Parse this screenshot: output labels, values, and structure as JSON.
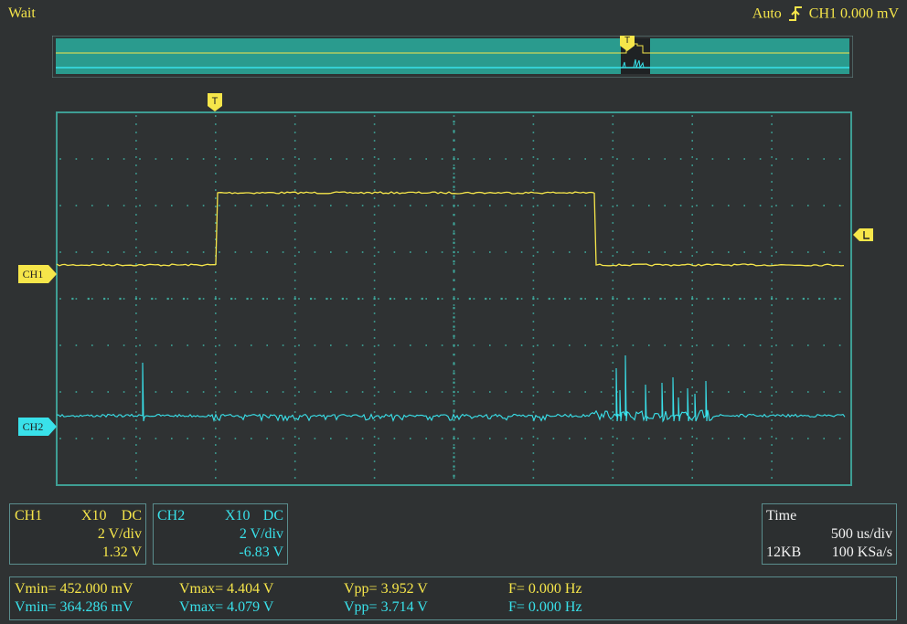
{
  "header": {
    "status": "Wait",
    "trigger_mode": "Auto",
    "trigger_source": "CH1",
    "trigger_level": "0.000 mV"
  },
  "markers": {
    "trigger": "T",
    "ch1": "CH1",
    "ch2": "CH2"
  },
  "colors": {
    "ch1": "#f6e64a",
    "ch2": "#39e1ea",
    "grid_border": "#3e9e94",
    "background": "#2f3233",
    "overview_fill": "#2a9b8e"
  },
  "channels": [
    {
      "name": "CH1",
      "probe": "X10",
      "coupling": "DC",
      "scale": "2 V/div",
      "offset": "1.32 V"
    },
    {
      "name": "CH2",
      "probe": "X10",
      "coupling": "DC",
      "scale": "2 V/div",
      "offset": "-6.83 V"
    }
  ],
  "timebase": {
    "label": "Time",
    "scale": "500 us/div",
    "memory": "12KB",
    "sample_rate": "100 KSa/s"
  },
  "measurements": [
    {
      "vmin": "Vmin= 452.000 mV",
      "vmax": "Vmax= 4.404 V",
      "vpp": "Vpp= 3.952 V",
      "freq": "F= 0.000 Hz"
    },
    {
      "vmin": "Vmin= 364.286 mV",
      "vmax": "Vmax= 4.079 V",
      "vpp": "Vpp= 3.714 V",
      "freq": "F= 0.000 Hz"
    }
  ]
}
